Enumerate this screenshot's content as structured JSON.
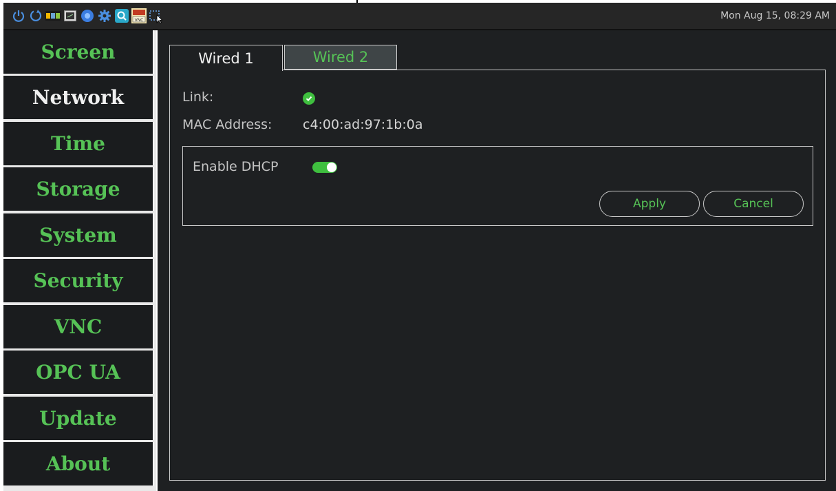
{
  "taskbar": {
    "icons": [
      "power-icon",
      "refresh-icon",
      "nxp-logo-icon",
      "terminal-icon",
      "browser-icon",
      "settings-gear-icon",
      "search-app-icon",
      "tightvnc-icon",
      "screenshot-select-icon"
    ],
    "clock": "Mon Aug 15, 08:29 AM"
  },
  "sidebar": {
    "items": [
      {
        "label": "Screen",
        "active": false
      },
      {
        "label": "Network",
        "active": true
      },
      {
        "label": "Time",
        "active": false
      },
      {
        "label": "Storage",
        "active": false
      },
      {
        "label": "System",
        "active": false
      },
      {
        "label": "Security",
        "active": false
      },
      {
        "label": "VNC",
        "active": false
      },
      {
        "label": "OPC UA",
        "active": false
      },
      {
        "label": "Update",
        "active": false
      },
      {
        "label": "About",
        "active": false
      }
    ]
  },
  "tabs": [
    {
      "label": "Wired 1",
      "active": true
    },
    {
      "label": "Wired 2",
      "active": false
    }
  ],
  "network": {
    "link_label": "Link:",
    "link_status": "connected",
    "mac_label": "MAC Address:",
    "mac_value": "c4:00:ad:97:1b:0a",
    "dhcp_label": "Enable DHCP",
    "dhcp_enabled": true,
    "apply_label": "Apply",
    "cancel_label": "Cancel"
  },
  "colors": {
    "accent_green": "#56c256",
    "panel_bg": "#1e2022",
    "sidebar_bg": "#1a1c1e",
    "taskbar_bg": "#262626"
  }
}
